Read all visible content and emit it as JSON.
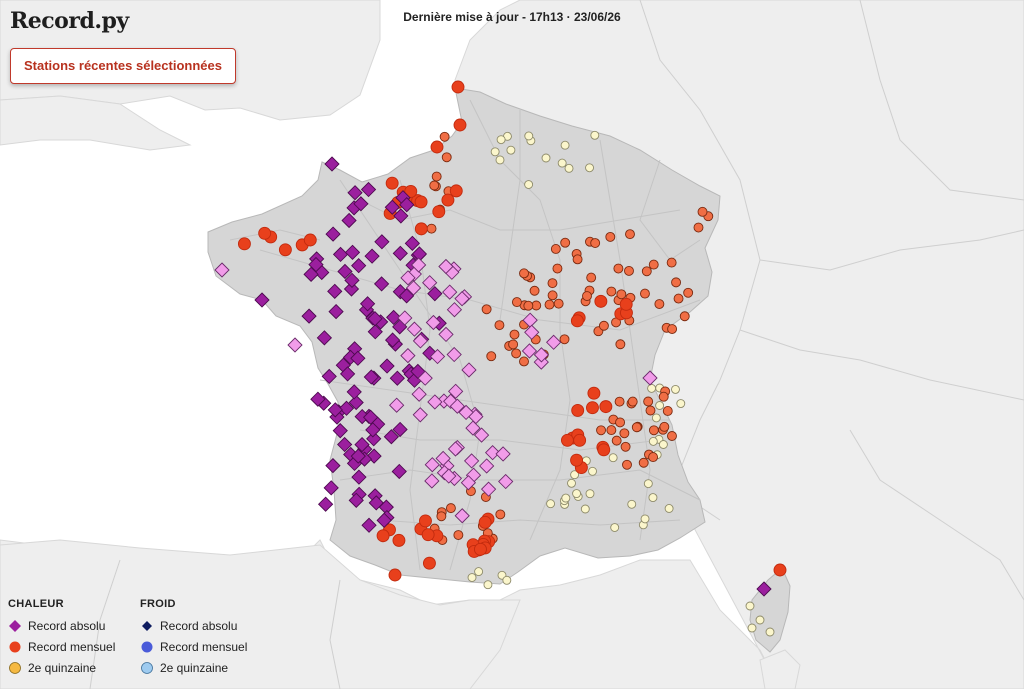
{
  "header": {
    "logo": "Record.py",
    "update_text": "Dernière mise à jour - 17h13 · 23/06/26"
  },
  "selection_button": {
    "label": "Stations récentes sélectionnées"
  },
  "legend": {
    "heat": {
      "title": "CHALEUR",
      "items": [
        {
          "label": "Record absolu",
          "symbol": "diamond",
          "color": "#9b1f9e"
        },
        {
          "label": "Record mensuel",
          "symbol": "circle",
          "color": "#e8401c"
        },
        {
          "label": "2e quinzaine",
          "symbol": "circle",
          "color": "#f5b942"
        }
      ]
    },
    "cold": {
      "title": "FROID",
      "items": [
        {
          "label": "Record absolu",
          "symbol": "diamond",
          "color": "#0d1b5e"
        },
        {
          "label": "Record mensuel",
          "symbol": "circle",
          "color": "#4a5bd9"
        },
        {
          "label": "2e quinzaine",
          "symbol": "circle",
          "color": "#9ecbf0"
        }
      ]
    }
  },
  "colors": {
    "sea": "#ffffff",
    "neighbors": "#eeeeee",
    "france_fill": "#d6d6d6",
    "borders": "#bcbcbc",
    "record_absolu_heat": "#9b1f9e",
    "record_absolu_heat_recent": "#f19ce9",
    "record_mensuel_heat": "#e8401c",
    "record_mensuel_heat_recent": "#f06e45",
    "quinzaine_pale": "#fbf6cc"
  }
}
